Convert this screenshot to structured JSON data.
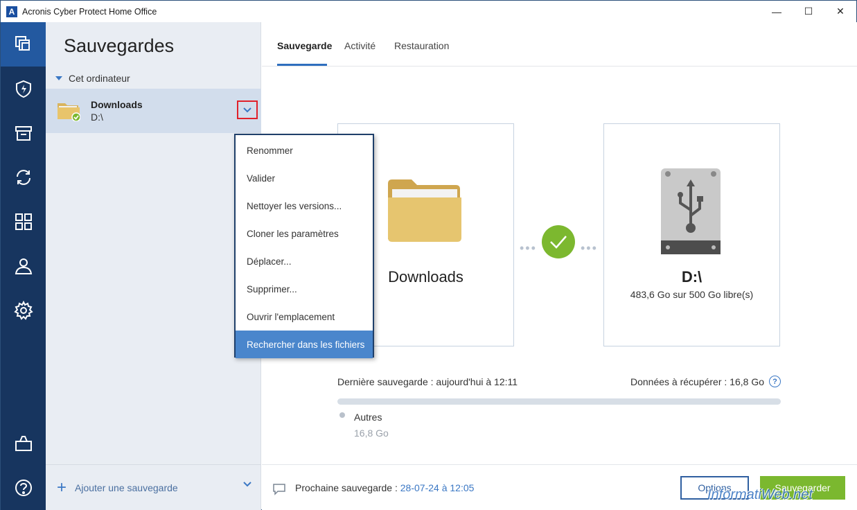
{
  "window": {
    "title": "Acronis Cyber Protect Home Office",
    "logo_letter": "A",
    "controls": {
      "minimize": "—",
      "maximize": "☐",
      "close": "✕"
    }
  },
  "rail": {
    "items": [
      {
        "icon": "backups-icon",
        "active": true
      },
      {
        "icon": "shield-icon",
        "active": false
      },
      {
        "icon": "archive-icon",
        "active": false
      },
      {
        "icon": "sync-icon",
        "active": false
      },
      {
        "icon": "tools-grid-icon",
        "active": false
      },
      {
        "icon": "account-icon",
        "active": false
      },
      {
        "icon": "settings-icon",
        "active": false
      },
      {
        "icon": "briefcase-icon",
        "active": false
      },
      {
        "icon": "help-icon",
        "active": false
      }
    ]
  },
  "panel": {
    "title": "Sauvegardes",
    "section": "Cet ordinateur",
    "item": {
      "name": "Downloads",
      "destination": "D:\\"
    },
    "add_label": "Ajouter une sauvegarde"
  },
  "tabs": [
    "Sauvegarde",
    "Activité",
    "Restauration"
  ],
  "source": {
    "name": "Downloads"
  },
  "destination": {
    "name": "D:\\",
    "free": "483,6 Go sur 500 Go libre(s)"
  },
  "info": {
    "last_backup": "Dernière sauvegarde : aujourd'hui à 12:11",
    "recoverable": "Données à récupérer : 16,8 Go",
    "help": "?"
  },
  "legend": {
    "label": "Autres",
    "size": "16,8 Go"
  },
  "footer": {
    "next_label": "Prochaine sauvegarde : ",
    "next_value": "28-07-24 à 12:05",
    "options": "Options",
    "save": "Sauvegarder"
  },
  "context_menu": {
    "items": [
      "Renommer",
      "Valider",
      "Nettoyer les versions...",
      "Cloner les paramètres",
      "Déplacer...",
      "Supprimer...",
      "Ouvrir l'emplacement",
      "Rechercher dans les fichiers"
    ],
    "highlighted_index": 7
  },
  "watermark": "InformatiWeb.net",
  "colors": {
    "rail": "#17355f",
    "accent": "#2f6fbf",
    "success": "#7cb82f",
    "highlight": "#4a86cc"
  }
}
